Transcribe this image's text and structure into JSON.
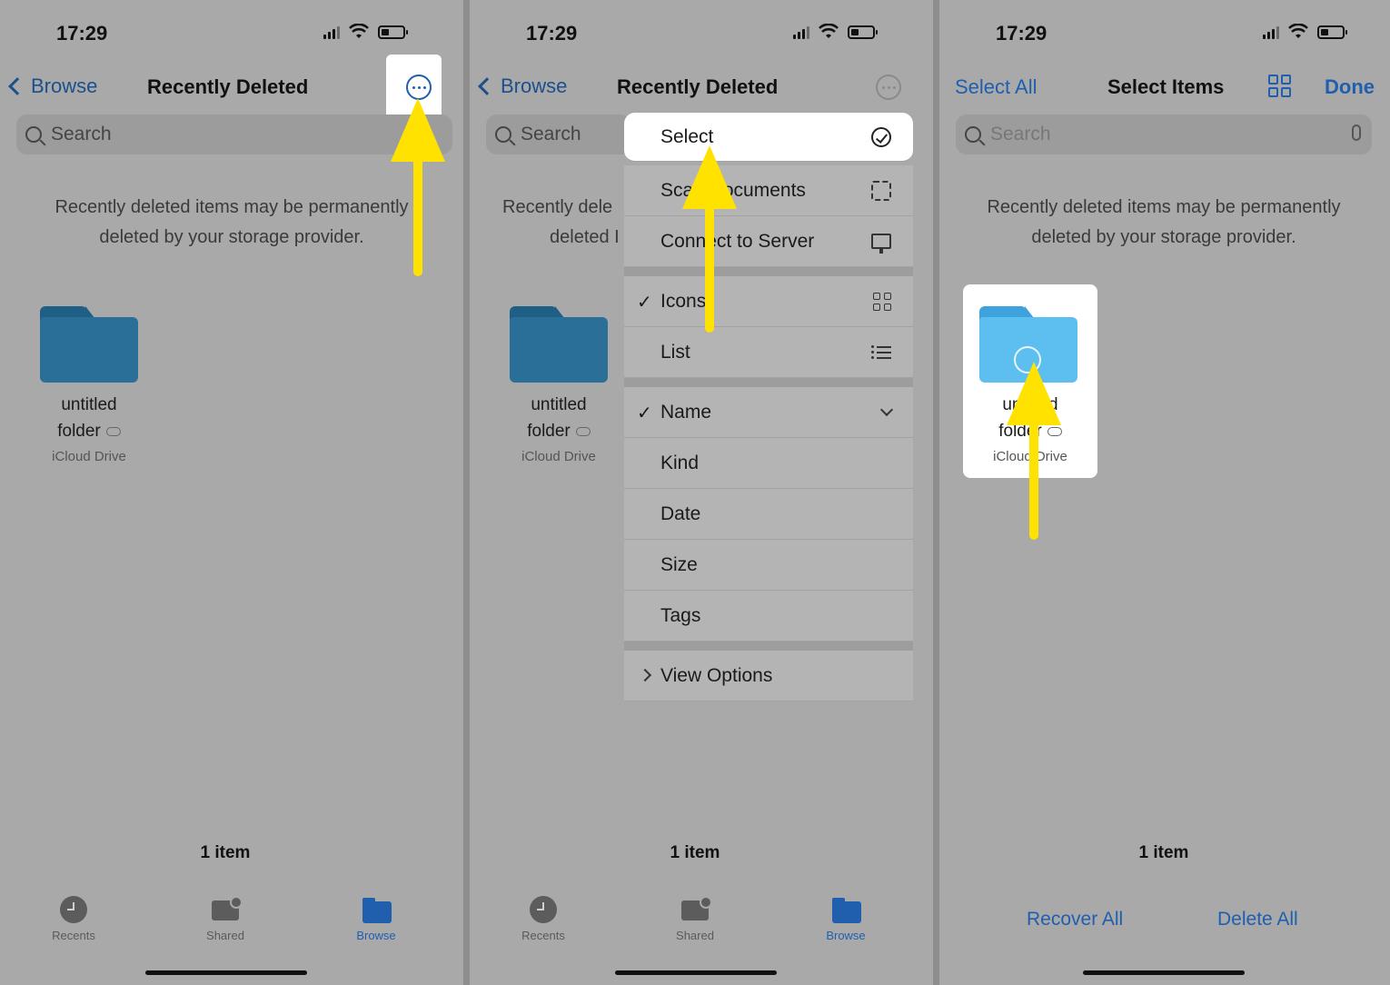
{
  "status": {
    "time": "17:29"
  },
  "panel1": {
    "back_label": "Browse",
    "title": "Recently Deleted",
    "search_placeholder": "Search",
    "info_line1": "Recently deleted items may be permanently",
    "info_line2": "deleted by your storage provider.",
    "folder": {
      "name_line1": "untitled",
      "name_line2": "folder",
      "location": "iCloud Drive"
    },
    "item_count": "1 item",
    "tabs": [
      {
        "label": "Recents",
        "icon": "clock-icon"
      },
      {
        "label": "Shared",
        "icon": "shared-folder-icon"
      },
      {
        "label": "Browse",
        "icon": "folder-icon",
        "active": true
      }
    ]
  },
  "panel2": {
    "back_label": "Browse",
    "title": "Recently Deleted",
    "search_placeholder": "Search",
    "info_fragment1": "Recently dele",
    "info_fragment2": "deleted I",
    "folder": {
      "name_line1": "untitled",
      "name_line2": "folder",
      "location": "iCloud Drive"
    },
    "menu": {
      "select": "Select",
      "scan": "Scan Documents",
      "connect": "Connect to Server",
      "icons": "Icons",
      "list": "List",
      "name": "Name",
      "kind": "Kind",
      "date": "Date",
      "size": "Size",
      "tags": "Tags",
      "view_options": "View Options"
    },
    "item_count": "1 item",
    "tabs": [
      {
        "label": "Recents"
      },
      {
        "label": "Shared"
      },
      {
        "label": "Browse"
      }
    ]
  },
  "panel3": {
    "select_all": "Select All",
    "title": "Select Items",
    "done": "Done",
    "search_placeholder": "Search",
    "info_line1": "Recently deleted items may be permanently",
    "info_line2": "deleted by your storage provider.",
    "folder": {
      "name_line1": "untitled",
      "name_line2": "folder",
      "location": "iCloud Drive"
    },
    "item_count": "1 item",
    "recover_all": "Recover All",
    "delete_all": "Delete All"
  },
  "colors": {
    "accent": "#1f5fae",
    "arrow": "#ffe200",
    "folder": "#2a6f97"
  }
}
